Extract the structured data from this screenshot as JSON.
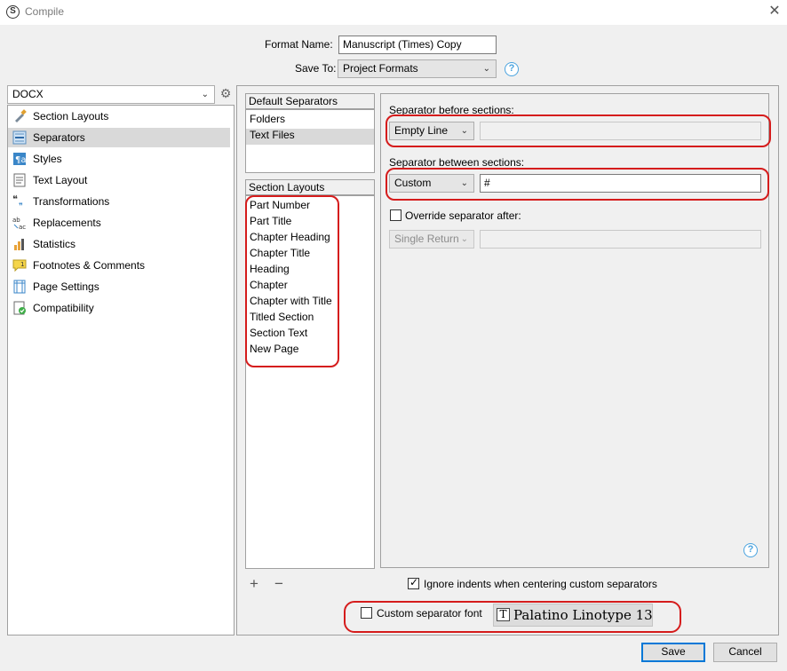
{
  "window": {
    "title": "Compile",
    "app_icon": "scrivener-logo-icon"
  },
  "top_form": {
    "format_name_label": "Format Name:",
    "format_name_value": "Manuscript (Times) Copy",
    "save_to_label": "Save To:",
    "save_to_value": "Project Formats"
  },
  "sidebar": {
    "format_select": "DOCX",
    "items": [
      {
        "label": "Section Layouts",
        "icon": "brush-icon"
      },
      {
        "label": "Separators",
        "icon": "separators-icon"
      },
      {
        "label": "Styles",
        "icon": "paragraph-styles-icon"
      },
      {
        "label": "Text Layout",
        "icon": "document-icon"
      },
      {
        "label": "Transformations",
        "icon": "quotes-transform-icon"
      },
      {
        "label": "Replacements",
        "icon": "replace-ab-ac-icon"
      },
      {
        "label": "Statistics",
        "icon": "bar-chart-icon"
      },
      {
        "label": "Footnotes & Comments",
        "icon": "comment-icon"
      },
      {
        "label": "Page Settings",
        "icon": "page-grid-icon"
      },
      {
        "label": "Compatibility",
        "icon": "compatibility-check-icon"
      }
    ]
  },
  "default_separators": {
    "header": "Default Separators",
    "items": [
      "Folders",
      "Text Files"
    ]
  },
  "section_layouts": {
    "header": "Section Layouts",
    "items": [
      "Part Number",
      "Part Title",
      "Chapter Heading",
      "Chapter Title",
      "Heading",
      "Chapter",
      "Chapter with Title",
      "Titled Section",
      "Section Text",
      "New Page"
    ]
  },
  "settings": {
    "before_label": "Separator before sections:",
    "before_value": "Empty Line",
    "between_label": "Separator between sections:",
    "between_value": "Custom",
    "between_custom_text": "#",
    "override_label": "Override separator after:",
    "override_value": "Single Return"
  },
  "bottom": {
    "add_symbol": "+",
    "remove_symbol": "−",
    "ignore_indents_label": "Ignore indents when centering custom separators",
    "custom_font_label": "Custom separator font",
    "font_value": "Palatino Linotype 13"
  },
  "buttons": {
    "save": "Save",
    "cancel": "Cancel"
  },
  "colors": {
    "highlight_ring": "#d51c1c",
    "help_blue": "#4aa3df",
    "selected_row": "#d9d9d9"
  }
}
